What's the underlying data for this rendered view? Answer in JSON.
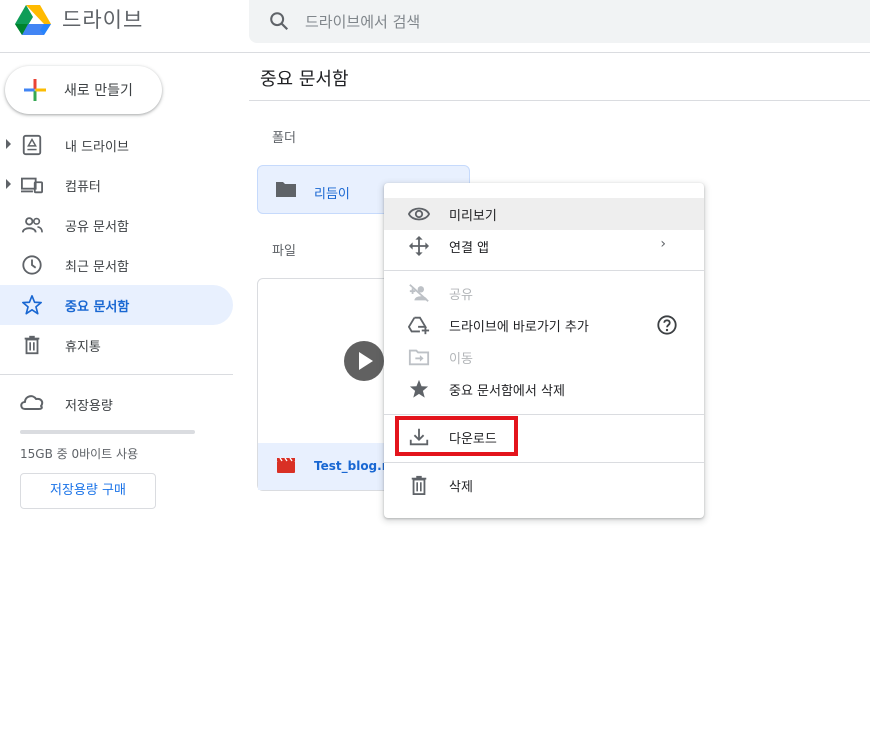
{
  "header": {
    "app_title": "드라이브",
    "search_placeholder": "드라이브에서 검색"
  },
  "sidebar": {
    "new_button_label": "새로 만들기",
    "items": [
      {
        "label": "내 드라이브",
        "icon": "my-drive-icon",
        "expandable": true,
        "active": false
      },
      {
        "label": "컴퓨터",
        "icon": "computer-icon",
        "expandable": true,
        "active": false
      },
      {
        "label": "공유 문서함",
        "icon": "shared-people-icon",
        "expandable": false,
        "active": false
      },
      {
        "label": "최근 문서함",
        "icon": "clock-icon",
        "expandable": false,
        "active": false
      },
      {
        "label": "중요 문서함",
        "icon": "star-icon",
        "expandable": false,
        "active": true
      },
      {
        "label": "휴지통",
        "icon": "trash-icon",
        "expandable": false,
        "active": false
      }
    ],
    "storage": {
      "label": "저장용량",
      "usage_text": "15GB 중 0바이트 사용",
      "used_fraction": 0,
      "buy_label": "저장용량 구매"
    }
  },
  "main": {
    "page_title": "중요 문서함",
    "folders_heading": "폴더",
    "folders": [
      {
        "name": "리듬이"
      }
    ],
    "files_heading": "파일",
    "files": [
      {
        "name": "Test_blog.m"
      }
    ]
  },
  "context_menu": {
    "items": [
      {
        "label": "미리보기",
        "icon": "eye-icon",
        "disabled": false,
        "hovered": true
      },
      {
        "label": "연결 앱",
        "icon": "move-arrows-icon",
        "disabled": false,
        "has_submenu": true
      },
      {
        "label": "공유",
        "icon": "share-person-icon",
        "disabled": true
      },
      {
        "label": "드라이브에 바로가기 추가",
        "icon": "add-shortcut-icon",
        "disabled": false,
        "has_help": true
      },
      {
        "label": "이동",
        "icon": "move-folder-icon",
        "disabled": true
      },
      {
        "label": "중요 문서함에서 삭제",
        "icon": "star-filled-icon",
        "disabled": false
      },
      {
        "label": "다운로드",
        "icon": "download-icon",
        "disabled": false,
        "highlighted": true
      },
      {
        "label": "삭제",
        "icon": "trash-icon",
        "disabled": false
      }
    ],
    "submenu_indicator": "›"
  },
  "colors": {
    "accent": "#1a73e8",
    "active_nav_bg": "#e8f0fe",
    "highlight_box": "#e3141c"
  }
}
